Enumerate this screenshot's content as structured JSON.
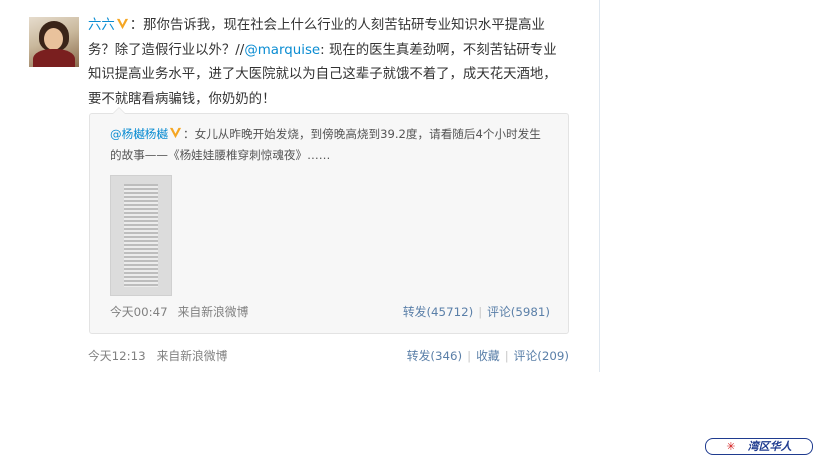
{
  "post": {
    "author": "六六",
    "colon": "：",
    "text_before_mention": "那你告诉我，现在社会上什么行业的人刻苦钻研专业知识水平提高业务？除了造假行业以外？//",
    "mention": "@marquise",
    "text_after_mention": ": 现在的医生真差劲啊，不刻苦钻研专业知识提高业务水平，进了大医院就以为自己这辈子就饿不着了，成天花天酒地，要不就瞎看病骗钱，你奶奶的！",
    "time": "今天12:13",
    "source": "来自新浪微博",
    "actions": [
      "转发(346)",
      "收藏",
      "评论(209)"
    ],
    "separator": "|"
  },
  "repost": {
    "author": "@杨樾杨樾",
    "colon": "：",
    "text": "女儿从昨晚开始发烧，到傍晚高烧到39.2度，请看随后4个小时发生的故事——《杨娃娃腰椎穿刺惊魂夜》……",
    "time": "今天00:47",
    "source": "来自新浪微博",
    "actions": [
      "转发(45712)",
      "评论(5981)"
    ],
    "separator": "|"
  },
  "watermark": {
    "text": "湾区华人",
    "star": "✳"
  },
  "colors": {
    "link": "#0a8cd2",
    "badge": "#f5a623",
    "action": "#5a7fa8",
    "meta": "#808080",
    "watermark": "#1f3b8f",
    "watermark_star": "#d21c1c"
  },
  "icons": [
    "avatar-image",
    "verified-v-icon",
    "thumbnail-image"
  ]
}
